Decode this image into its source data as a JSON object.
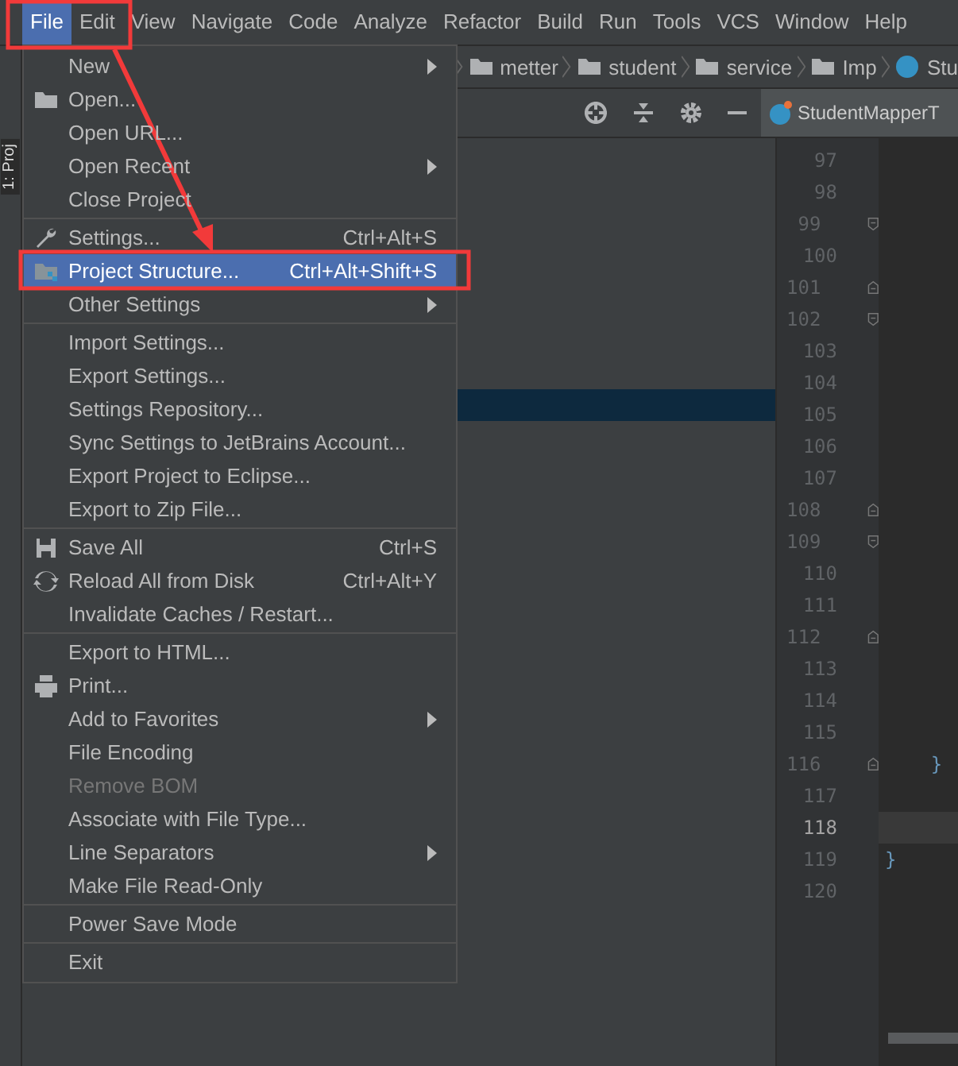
{
  "menu_bar": [
    {
      "label": "File",
      "selected": true
    },
    {
      "label": "Edit",
      "selected": false
    },
    {
      "label": "View",
      "selected": false
    },
    {
      "label": "Navigate",
      "selected": false
    },
    {
      "label": "Code",
      "selected": false
    },
    {
      "label": "Analyze",
      "selected": false
    },
    {
      "label": "Refactor",
      "selected": false
    },
    {
      "label": "Build",
      "selected": false
    },
    {
      "label": "Run",
      "selected": false
    },
    {
      "label": "Tools",
      "selected": false
    },
    {
      "label": "VCS",
      "selected": false
    },
    {
      "label": "Window",
      "selected": false
    },
    {
      "label": "Help",
      "selected": false
    }
  ],
  "side_tab": {
    "label": "1: Proj"
  },
  "breadcrumbs": [
    {
      "label": "metter",
      "kind": "folder"
    },
    {
      "label": "student",
      "kind": "folder"
    },
    {
      "label": "service",
      "kind": "folder"
    },
    {
      "label": "Imp",
      "kind": "folder"
    },
    {
      "label": "Stu",
      "kind": "class"
    }
  ],
  "editor_tab": {
    "label": "StudentMapperT"
  },
  "file_menu": [
    {
      "kind": "plain",
      "label": "New",
      "submenu": true,
      "disabled": false,
      "selected": false
    },
    {
      "kind": "open",
      "label": "Open...",
      "submenu": false,
      "disabled": false,
      "selected": false
    },
    {
      "kind": "plain",
      "label": "Open URL...",
      "submenu": false,
      "disabled": false,
      "selected": false
    },
    {
      "kind": "plain",
      "label": "Open Recent",
      "submenu": true,
      "disabled": false,
      "selected": false
    },
    {
      "kind": "plain",
      "label": "Close Project",
      "submenu": false,
      "disabled": false,
      "selected": false
    },
    {
      "kind": "separator"
    },
    {
      "kind": "settings",
      "label": "Settings...",
      "shortcut": "Ctrl+Alt+S",
      "submenu": false,
      "disabled": false,
      "selected": false
    },
    {
      "kind": "structure",
      "label": "Project Structure...",
      "shortcut": "Ctrl+Alt+Shift+S",
      "submenu": false,
      "disabled": false,
      "selected": true
    },
    {
      "kind": "plain",
      "label": "Other Settings",
      "submenu": true,
      "disabled": false,
      "selected": false
    },
    {
      "kind": "separator"
    },
    {
      "kind": "plain",
      "label": "Import Settings...",
      "submenu": false,
      "disabled": false,
      "selected": false
    },
    {
      "kind": "plain",
      "label": "Export Settings...",
      "submenu": false,
      "disabled": false,
      "selected": false
    },
    {
      "kind": "plain",
      "label": "Settings Repository...",
      "submenu": false,
      "disabled": false,
      "selected": false
    },
    {
      "kind": "plain",
      "label": "Sync Settings to JetBrains Account...",
      "submenu": false,
      "disabled": false,
      "selected": false
    },
    {
      "kind": "plain",
      "label": "Export Project to Eclipse...",
      "submenu": false,
      "disabled": false,
      "selected": false
    },
    {
      "kind": "plain",
      "label": "Export to Zip File...",
      "submenu": false,
      "disabled": false,
      "selected": false
    },
    {
      "kind": "separator"
    },
    {
      "kind": "save",
      "label": "Save All",
      "shortcut": "Ctrl+S",
      "submenu": false,
      "disabled": false,
      "selected": false
    },
    {
      "kind": "reload",
      "label": "Reload All from Disk",
      "shortcut": "Ctrl+Alt+Y",
      "submenu": false,
      "disabled": false,
      "selected": false
    },
    {
      "kind": "plain",
      "label": "Invalidate Caches / Restart...",
      "submenu": false,
      "disabled": false,
      "selected": false
    },
    {
      "kind": "separator"
    },
    {
      "kind": "plain",
      "label": "Export to HTML...",
      "submenu": false,
      "disabled": false,
      "selected": false
    },
    {
      "kind": "print",
      "label": "Print...",
      "submenu": false,
      "disabled": false,
      "selected": false
    },
    {
      "kind": "plain",
      "label": "Add to Favorites",
      "submenu": true,
      "disabled": false,
      "selected": false
    },
    {
      "kind": "plain",
      "label": "File Encoding",
      "submenu": false,
      "disabled": false,
      "selected": false
    },
    {
      "kind": "plain",
      "label": "Remove BOM",
      "submenu": false,
      "disabled": true,
      "selected": false
    },
    {
      "kind": "plain",
      "label": "Associate with File Type...",
      "submenu": false,
      "disabled": false,
      "selected": false
    },
    {
      "kind": "plain",
      "label": "Line Separators",
      "submenu": true,
      "disabled": false,
      "selected": false
    },
    {
      "kind": "plain",
      "label": "Make File Read-Only",
      "submenu": false,
      "disabled": false,
      "selected": false
    },
    {
      "kind": "separator"
    },
    {
      "kind": "plain",
      "label": "Power Save Mode",
      "submenu": false,
      "disabled": false,
      "selected": false
    },
    {
      "kind": "separator"
    },
    {
      "kind": "plain",
      "label": "Exit",
      "submenu": false,
      "disabled": false,
      "selected": false
    }
  ],
  "editor_lines": [
    {
      "number": "97",
      "kind": "plain",
      "current": false
    },
    {
      "number": "98",
      "kind": "plain",
      "current": false
    },
    {
      "number": "99",
      "kind": "fold-start",
      "current": false
    },
    {
      "number": "100",
      "kind": "plain",
      "current": false
    },
    {
      "number": "101",
      "kind": "fold-end",
      "current": false
    },
    {
      "number": "102",
      "kind": "fold-start",
      "current": false
    },
    {
      "number": "103",
      "kind": "plain",
      "current": false
    },
    {
      "number": "104",
      "kind": "plain",
      "current": false
    },
    {
      "number": "105",
      "kind": "plain",
      "current": false
    },
    {
      "number": "106",
      "kind": "plain",
      "current": false
    },
    {
      "number": "107",
      "kind": "plain",
      "current": false
    },
    {
      "number": "108",
      "kind": "fold-end",
      "current": false
    },
    {
      "number": "109",
      "kind": "fold-start",
      "current": false
    },
    {
      "number": "110",
      "kind": "plain",
      "current": false
    },
    {
      "number": "111",
      "kind": "plain",
      "current": false
    },
    {
      "number": "112",
      "kind": "fold-end",
      "current": false
    },
    {
      "number": "113",
      "kind": "plain",
      "current": false
    },
    {
      "number": "114",
      "kind": "plain",
      "current": false
    },
    {
      "number": "115",
      "kind": "plain",
      "current": false
    },
    {
      "number": "116",
      "kind": "fold-end",
      "current": false,
      "code": "    }"
    },
    {
      "number": "117",
      "kind": "plain",
      "current": false
    },
    {
      "number": "118",
      "kind": "plain",
      "current": true
    },
    {
      "number": "119",
      "kind": "plain",
      "current": false,
      "code": "}"
    },
    {
      "number": "120",
      "kind": "plain",
      "current": false
    }
  ]
}
